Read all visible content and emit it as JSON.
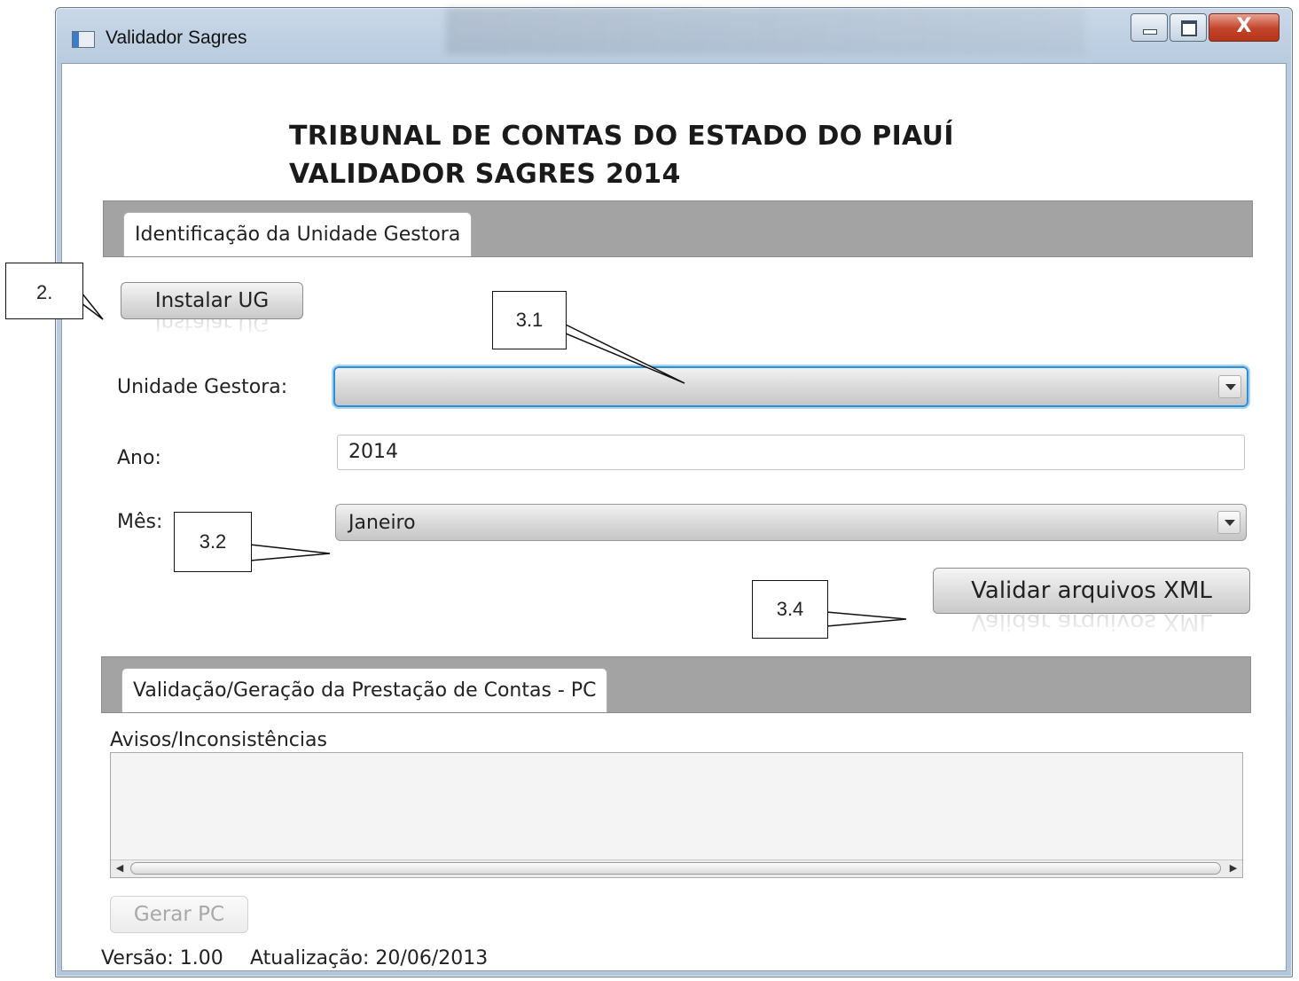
{
  "window": {
    "title": "Validador Sagres",
    "close_glyph": "X"
  },
  "header": {
    "line1": "TRIBUNAL DE CONTAS DO ESTADO DO PIAUÍ",
    "line2": "VALIDADOR SAGRES 2014"
  },
  "tabs": {
    "identificacao": "Identificação da Unidade Gestora",
    "validacao": "Validação/Geração da Prestação de Contas - PC"
  },
  "buttons": {
    "instalar": "Instalar UG",
    "validar": "Validar arquivos XML",
    "gerar": "Gerar PC"
  },
  "form": {
    "unidade_label": "Unidade Gestora:",
    "unidade_value": "",
    "ano_label": "Ano:",
    "ano_value": "2014",
    "mes_label": "Mês:",
    "mes_value": "Janeiro"
  },
  "warnings": {
    "label": "Avisos/Inconsistências",
    "content": ""
  },
  "footer": {
    "versao": "Versão: 1.00",
    "atualizacao": "Atualização: 20/06/2013"
  },
  "callouts": {
    "c2": "2.",
    "c31": "3.1",
    "c32": "3.2",
    "c34": "3.4"
  },
  "icons": [
    "app-icon",
    "minimize-icon",
    "maximize-icon",
    "close-icon",
    "dropdown-arrow-icon",
    "scroll-left-icon",
    "scroll-right-icon"
  ]
}
